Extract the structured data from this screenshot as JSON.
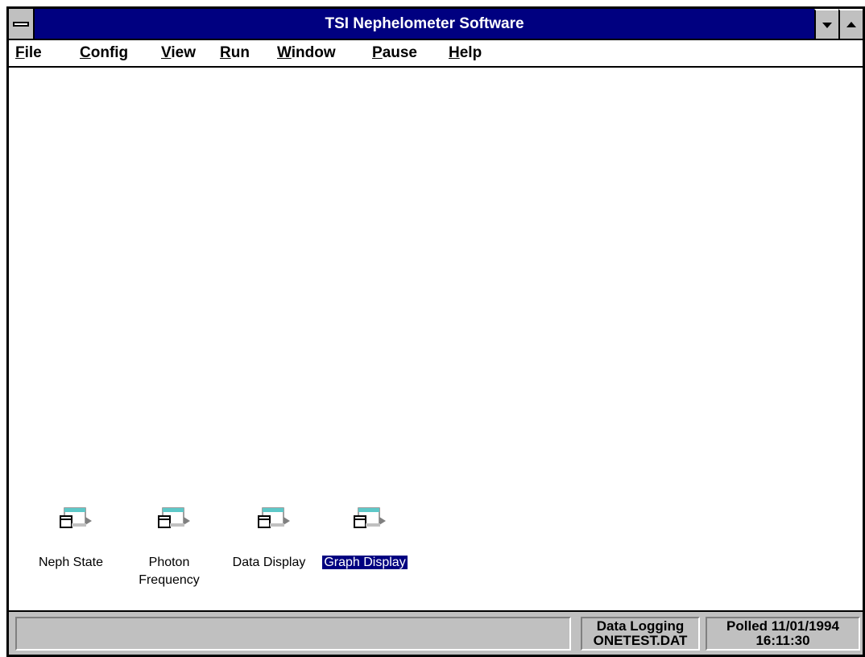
{
  "window": {
    "title": "TSI Nephelometer Software",
    "accent_color": "#000080",
    "buttons": {
      "system_icon": "system-menu-icon",
      "minimize_icon": "minimize-triangle-icon",
      "maximize_icon": "maximize-triangle-icon"
    }
  },
  "menubar": {
    "items": [
      {
        "mnemonic": "F",
        "rest": "ile"
      },
      {
        "mnemonic": "C",
        "rest": "onfig"
      },
      {
        "mnemonic": "V",
        "rest": "iew"
      },
      {
        "mnemonic": "R",
        "rest": "un"
      },
      {
        "mnemonic": "W",
        "rest": "indow"
      },
      {
        "mnemonic": "P",
        "rest": "ause"
      },
      {
        "mnemonic": "H",
        "rest": "elp"
      }
    ]
  },
  "minimized_windows": [
    {
      "label": "Neph State",
      "icon": "minimized-window-icon",
      "selected": false
    },
    {
      "label": "Photon Frequency",
      "icon": "minimized-window-icon",
      "selected": false
    },
    {
      "label": "Data Display",
      "icon": "minimized-window-icon",
      "selected": false
    },
    {
      "label": "Graph Display",
      "icon": "minimized-window-icon",
      "selected": true
    }
  ],
  "statusbar": {
    "main_text": "",
    "logging": {
      "line1": "Data Logging",
      "line2": "ONETEST.DAT"
    },
    "polled": {
      "line1": "Polled 11/01/1994",
      "line2": "16:11:30"
    }
  }
}
